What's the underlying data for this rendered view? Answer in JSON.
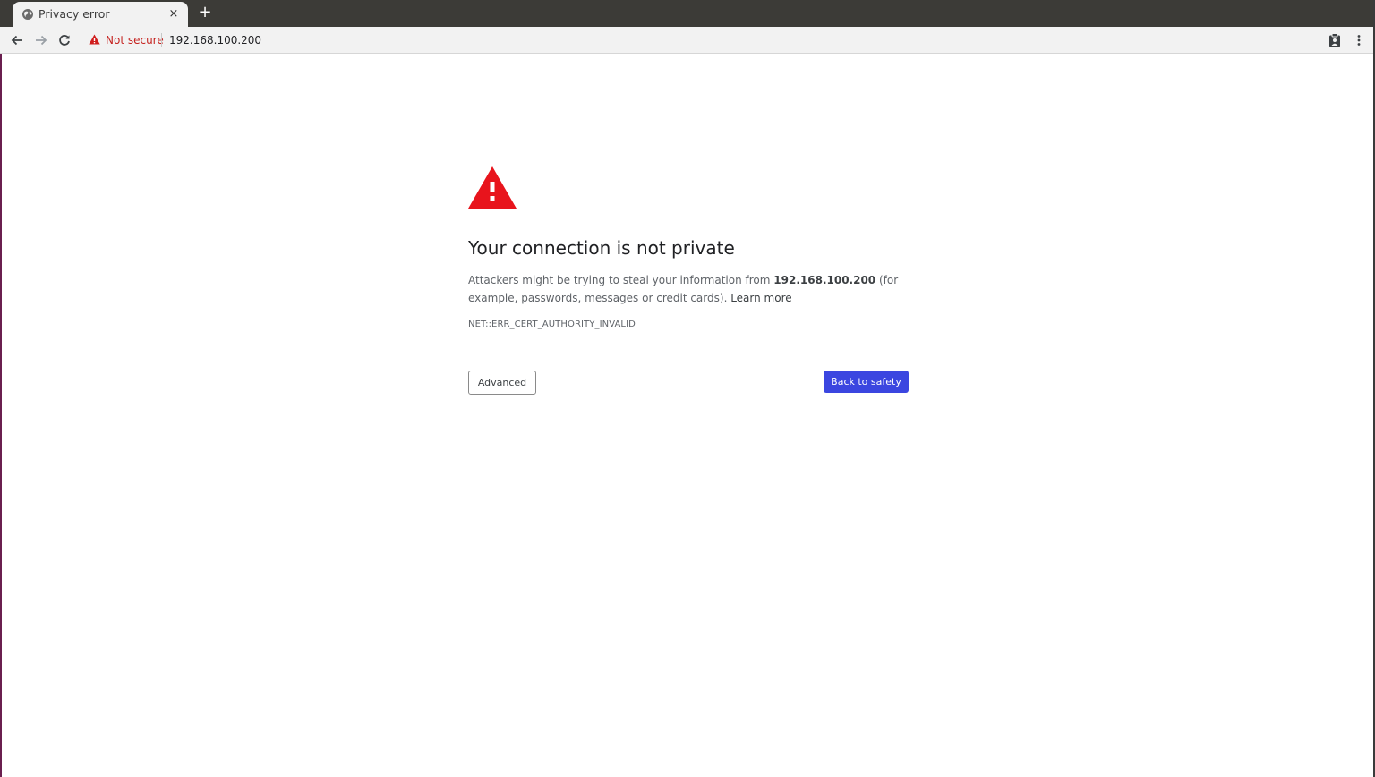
{
  "tab": {
    "title": "Privacy error",
    "close_glyph": "×",
    "icon": "globe-icon"
  },
  "new_tab": {
    "glyph": "+"
  },
  "toolbar": {
    "back_icon": "arrow-back-icon",
    "forward_icon": "arrow-forward-icon",
    "reload_icon": "reload-icon",
    "security_label": "Not secure",
    "security_icon": "warning-triangle-icon",
    "url": "192.168.100.200",
    "extension_icon": "clipboard-icon",
    "menu_icon": "kebab-menu-icon"
  },
  "interstitial": {
    "icon": "warning-triangle-icon",
    "heading": "Your connection is not private",
    "body_prefix": "Attackers might be trying to steal your information from ",
    "body_host": "192.168.100.200",
    "body_suffix": " (for example, passwords, messages or credit cards). ",
    "learn_more": "Learn more",
    "error_code": "NET::ERR_CERT_AUTHORITY_INVALID",
    "advanced_label": "Advanced",
    "back_label": "Back to safety"
  },
  "colors": {
    "warning_red": "#e8141c",
    "not_secure_red": "#c5221f",
    "primary_button": "#3b46e0",
    "tabstrip": "#3c3b37"
  }
}
